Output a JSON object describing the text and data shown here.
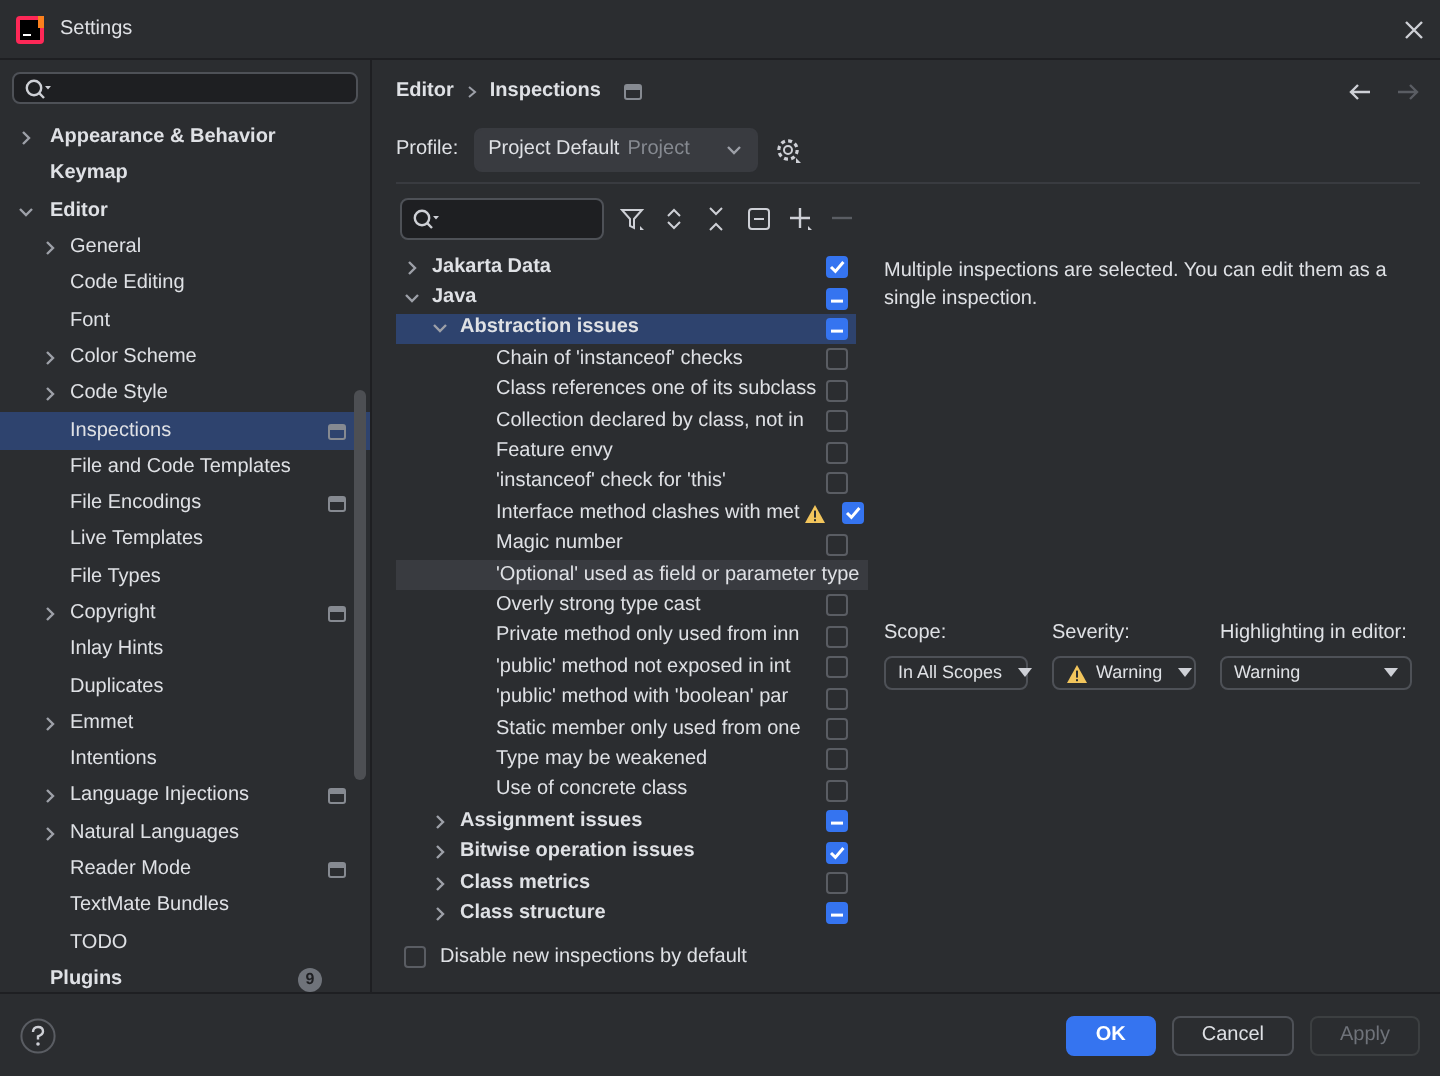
{
  "window": {
    "title": "Settings"
  },
  "sidebar": {
    "items": [
      {
        "label": "Appearance & Behavior",
        "bold": true,
        "expanded": false,
        "selected": false
      },
      {
        "label": "Keymap",
        "bold": true,
        "selected": false
      },
      {
        "label": "Editor",
        "bold": true,
        "expanded": true,
        "selected": false,
        "children": [
          {
            "label": "General",
            "expanded": false,
            "selected": false
          },
          {
            "label": "Code Editing",
            "selected": false
          },
          {
            "label": "Font",
            "selected": false
          },
          {
            "label": "Color Scheme",
            "expanded": false,
            "selected": false
          },
          {
            "label": "Code Style",
            "expanded": false,
            "selected": false
          },
          {
            "label": "Inspections",
            "selected": true,
            "project_scoped": true
          },
          {
            "label": "File and Code Templates",
            "selected": false
          },
          {
            "label": "File Encodings",
            "selected": false,
            "project_scoped": true
          },
          {
            "label": "Live Templates",
            "selected": false
          },
          {
            "label": "File Types",
            "selected": false
          },
          {
            "label": "Copyright",
            "expanded": false,
            "selected": false,
            "project_scoped": true
          },
          {
            "label": "Inlay Hints",
            "selected": false
          },
          {
            "label": "Duplicates",
            "selected": false
          },
          {
            "label": "Emmet",
            "expanded": false,
            "selected": false
          },
          {
            "label": "Intentions",
            "selected": false
          },
          {
            "label": "Language Injections",
            "expanded": false,
            "selected": false,
            "project_scoped": true
          },
          {
            "label": "Natural Languages",
            "expanded": false,
            "selected": false
          },
          {
            "label": "Reader Mode",
            "selected": false,
            "project_scoped": true
          },
          {
            "label": "TextMate Bundles",
            "selected": false
          },
          {
            "label": "TODO",
            "selected": false
          }
        ]
      },
      {
        "label": "Plugins",
        "bold": true,
        "selected": false,
        "badge": "9"
      }
    ]
  },
  "breadcrumb": [
    "Editor",
    "Inspections"
  ],
  "profile": {
    "label": "Profile:",
    "value": "Project Default",
    "scope": "Project"
  },
  "inspections": [
    {
      "label": "Jakarta Data",
      "bold": true,
      "expanded": false,
      "checked": true,
      "mixed": false,
      "selected": false
    },
    {
      "label": "Java",
      "bold": true,
      "expanded": true,
      "checked": true,
      "mixed": true,
      "selected": false,
      "children": [
        {
          "label": "Abstraction issues",
          "bold": true,
          "expanded": true,
          "checked": true,
          "mixed": true,
          "selected": true,
          "children": [
            {
              "label": "Chain of 'instanceof' checks",
              "checked": false,
              "mixed": false,
              "selected": false
            },
            {
              "label": "Class references one of its subclass",
              "checked": false,
              "mixed": false,
              "selected": false
            },
            {
              "label": "Collection declared by class, not in",
              "checked": false,
              "mixed": false,
              "selected": false
            },
            {
              "label": "Feature envy",
              "checked": false,
              "mixed": false,
              "selected": false
            },
            {
              "label": "'instanceof' check for 'this'",
              "checked": false,
              "mixed": false,
              "selected": false
            },
            {
              "label": "Interface method clashes with met",
              "checked": true,
              "mixed": false,
              "selected": false,
              "warning": true
            },
            {
              "label": "Magic number",
              "checked": false,
              "mixed": false,
              "selected": false
            },
            {
              "label": "'Optional' used as field or parameter type",
              "selected": false,
              "hovered": true
            },
            {
              "label": "Overly strong type cast",
              "checked": false,
              "mixed": false,
              "selected": false
            },
            {
              "label": "Private method only used from inn",
              "checked": false,
              "mixed": false,
              "selected": false
            },
            {
              "label": "'public' method not exposed in int",
              "checked": false,
              "mixed": false,
              "selected": false
            },
            {
              "label": "'public' method with 'boolean' par",
              "checked": false,
              "mixed": false,
              "selected": false
            },
            {
              "label": "Static member only used from one",
              "checked": false,
              "mixed": false,
              "selected": false
            },
            {
              "label": "Type may be weakened",
              "checked": false,
              "mixed": false,
              "selected": false
            },
            {
              "label": "Use of concrete class",
              "checked": false,
              "mixed": false,
              "selected": false
            }
          ]
        },
        {
          "label": "Assignment issues",
          "bold": true,
          "expanded": false,
          "checked": true,
          "mixed": true,
          "selected": false
        },
        {
          "label": "Bitwise operation issues",
          "bold": true,
          "expanded": false,
          "checked": true,
          "mixed": false,
          "selected": false
        },
        {
          "label": "Class metrics",
          "bold": true,
          "expanded": false,
          "checked": false,
          "mixed": false,
          "selected": false
        },
        {
          "label": "Class structure",
          "bold": true,
          "expanded": false,
          "checked": true,
          "mixed": true,
          "selected": false
        }
      ]
    }
  ],
  "disable_new": {
    "label": "Disable new inspections by default",
    "checked": false
  },
  "info": "Multiple inspections are selected. You can edit them as a single inspection.",
  "settings": [
    {
      "label": "Scope:",
      "value": "In All Scopes",
      "warning": false
    },
    {
      "label": "Severity:",
      "value": "Warning",
      "warning": true
    },
    {
      "label": "Highlighting in editor:",
      "value": "Warning",
      "warning": false
    }
  ],
  "buttons": [
    {
      "label": "OK",
      "kind": "primary",
      "disabled": false
    },
    {
      "label": "Cancel",
      "kind": "secondary",
      "disabled": false
    },
    {
      "label": "Apply",
      "kind": "secondary",
      "disabled": true
    }
  ]
}
